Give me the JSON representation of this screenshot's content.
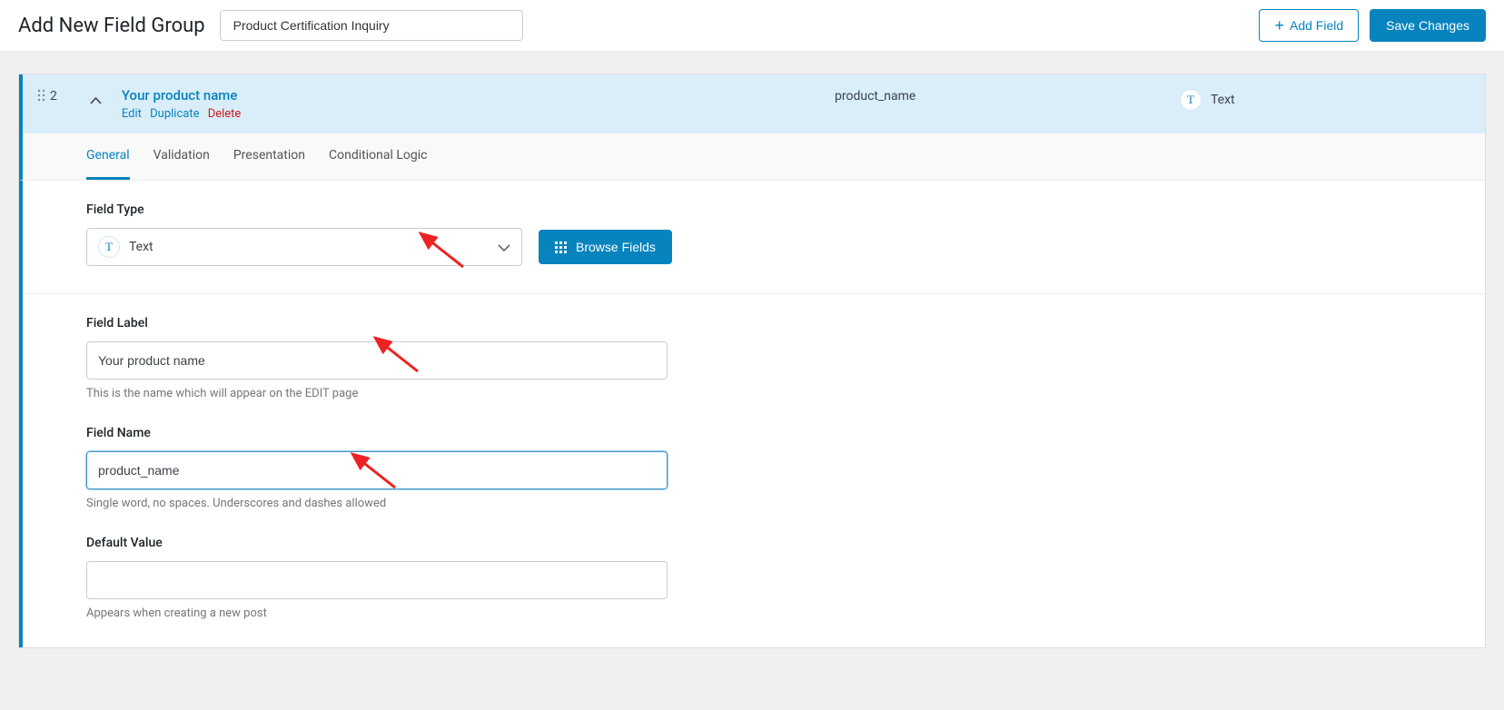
{
  "header": {
    "page_title": "Add New Field Group",
    "group_title": "Product Certification Inquiry",
    "add_field_label": "Add Field",
    "save_label": "Save Changes"
  },
  "field_row": {
    "number": "2",
    "label": "Your product name",
    "name": "product_name",
    "type": "Text",
    "actions": {
      "edit": "Edit",
      "duplicate": "Duplicate",
      "delete": "Delete"
    }
  },
  "tabs": {
    "general": "General",
    "validation": "Validation",
    "presentation": "Presentation",
    "conditional": "Conditional Logic"
  },
  "editor": {
    "field_type": {
      "label": "Field Type",
      "value": "Text",
      "browse_label": "Browse Fields"
    },
    "field_label": {
      "label": "Field Label",
      "value": "Your product name",
      "help": "This is the name which will appear on the EDIT page"
    },
    "field_name": {
      "label": "Field Name",
      "value": "product_name",
      "help": "Single word, no spaces. Underscores and dashes allowed"
    },
    "default_value": {
      "label": "Default Value",
      "value": "",
      "help": "Appears when creating a new post"
    }
  }
}
